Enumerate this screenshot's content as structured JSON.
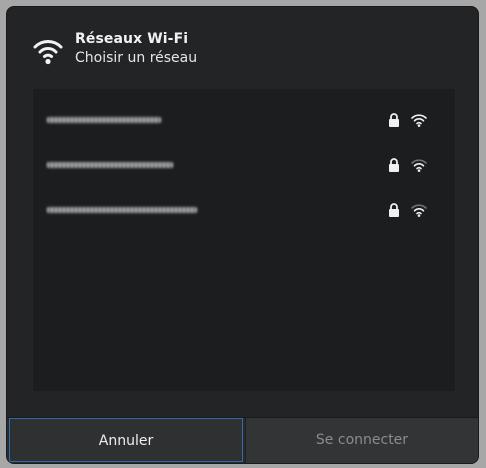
{
  "dialog": {
    "title": "Réseaux Wi-Fi",
    "subtitle": "Choisir un réseau",
    "icon": "wifi-icon"
  },
  "networks": [
    {
      "ssid": "xxxxxxxxxxxxxx",
      "secured": true,
      "signal": "strong",
      "lock_icon": "lock-icon",
      "signal_icon": "wifi-signal-icon"
    },
    {
      "ssid": "xxxxxxxxxxxxxxxxx",
      "secured": true,
      "signal": "good",
      "lock_icon": "lock-icon",
      "signal_icon": "wifi-signal-icon"
    },
    {
      "ssid": "xxxxxxxxxxxxxxxxxxxxxxxx",
      "secured": true,
      "signal": "good",
      "lock_icon": "lock-icon",
      "signal_icon": "wifi-signal-icon"
    }
  ],
  "footer": {
    "cancel_label": "Annuler",
    "connect_label": "Se connecter"
  },
  "colors": {
    "dialog_bg": "#232425",
    "list_bg": "#1c1d1f",
    "focus_border": "#2f6cae",
    "disabled_text": "#8b8c8d"
  }
}
